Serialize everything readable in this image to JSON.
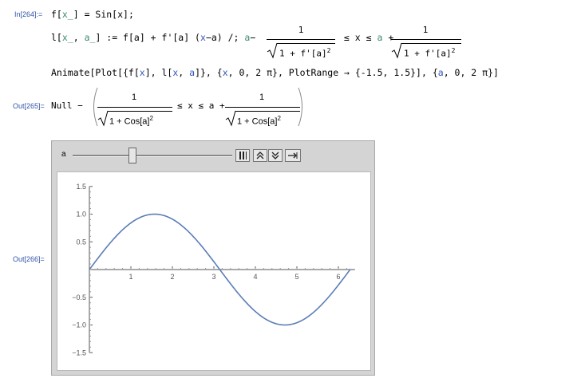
{
  "cells": {
    "in264": "In[264]:=",
    "out265": "Out[265]=",
    "out266": "Out[266]="
  },
  "line1": {
    "a": "f[",
    "b": "x_",
    "c": "] = Sin[",
    "d": "x",
    "e": "];"
  },
  "line2": {
    "lhs_a": "l[",
    "x_": "x_",
    "comma": ", ",
    "a_": "a_",
    "rhs": "] := f[a] + f'[a] (",
    "x": "x",
    "minus_a": "−a) /; ",
    "a_var": "a",
    "minus": "−",
    "frac_num": "1",
    "frac_den": "1 + f'[a]",
    "sup": "2",
    "leq_x_leq": " ≤ x ≤ ",
    "a2": "a",
    "plus": " + "
  },
  "line3": {
    "p1": "Animate[Plot[{f[",
    "x1": "x",
    "p2": "], l[",
    "x2": "x",
    "p3": ", ",
    "a1": "a",
    "p4": "]}, {",
    "x3": "x",
    "p5": ", 0, 2 π}, PlotRange → {-1.5, 1.5}], {",
    "a2": "a",
    "p6": ", 0, 2 π}]"
  },
  "output265": {
    "null_minus": "Null −",
    "num": "1",
    "den": "1 + Cos[a]",
    "sup": "2",
    "mid": "≤ x ≤ a +",
    "num2": "1",
    "den2": "1 + Cos[a]",
    "sup2": "2"
  },
  "animator": {
    "var_label": "a",
    "slider_value": 0.375,
    "buttons": [
      "⏸",
      "»",
      "˅",
      "→"
    ]
  },
  "chart_data": {
    "type": "line",
    "title": "",
    "xlabel": "",
    "ylabel": "",
    "xlim": [
      0,
      6.4
    ],
    "ylim": [
      -1.5,
      1.5
    ],
    "x_ticks": [
      "1",
      "2",
      "3",
      "4",
      "5",
      "6"
    ],
    "y_ticks": [
      "1.5",
      "1.0",
      "0.5",
      "−0.5",
      "−1.0",
      "−1.5"
    ],
    "y_tick_values": [
      1.5,
      1.0,
      0.5,
      -0.5,
      -1.0,
      -1.5
    ],
    "x_tick_values": [
      1,
      2,
      3,
      4,
      5,
      6
    ],
    "series": [
      {
        "function": "sin(x)",
        "x_range": [
          0,
          6.283
        ],
        "color": "#5b7db7"
      }
    ]
  }
}
